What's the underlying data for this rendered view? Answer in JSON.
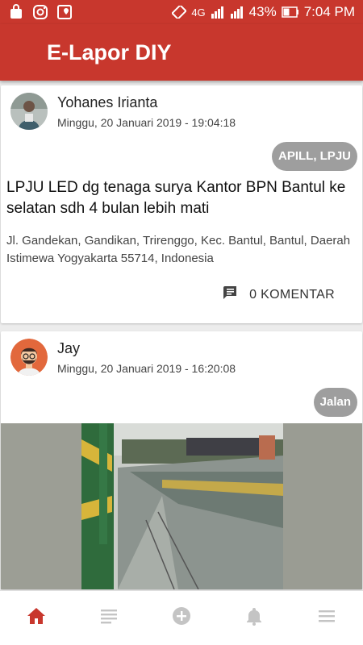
{
  "status_bar": {
    "network": "4G",
    "battery": "43%",
    "time": "7:04 PM"
  },
  "app_bar": {
    "title": "E-Lapor DIY"
  },
  "colors": {
    "primary": "#c8372d",
    "tag_bg": "#9e9e9e",
    "nav_active": "#c8372d",
    "nav_inactive": "#c4c4c4"
  },
  "posts": [
    {
      "author": "Yohanes Irianta",
      "date": "Minggu, 20 Januari 2019 - 19:04:18",
      "tag": "APILL, LPJU",
      "title": "LPJU LED dg tenaga surya Kantor BPN Bantul ke selatan sdh 4 bulan lebih mati",
      "address": "Jl. Gandekan, Gandikan, Trirenggo, Kec. Bantul, Bantul, Daerah Istimewa Yogyakarta 55714, Indonesia",
      "comments": "0 KOMENTAR"
    },
    {
      "author": "Jay",
      "date": "Minggu, 20 Januari 2019 - 16:20:08",
      "tag": "Jalan"
    }
  ],
  "nav": [
    {
      "icon": "home-icon",
      "active": true
    },
    {
      "icon": "list-icon",
      "active": false
    },
    {
      "icon": "add-circle-icon",
      "active": false
    },
    {
      "icon": "bell-icon",
      "active": false
    },
    {
      "icon": "menu-icon",
      "active": false
    }
  ]
}
